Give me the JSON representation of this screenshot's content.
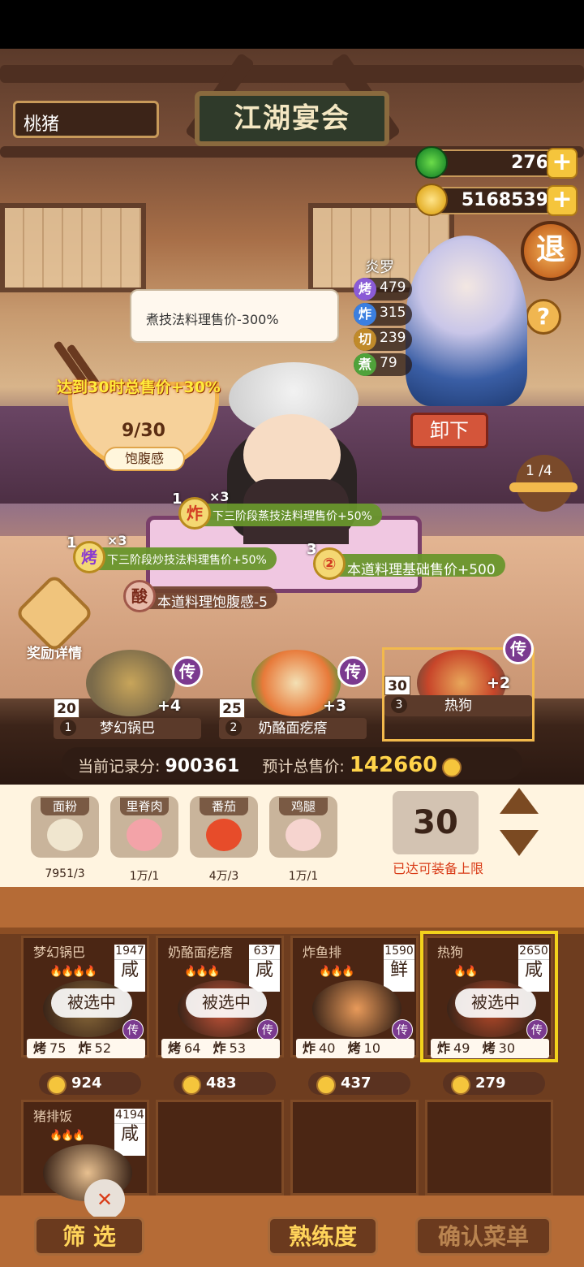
{
  "header": {
    "sign_title": "江湖宴会",
    "player_name": "桃猪",
    "jade": "276",
    "coins": "5168539",
    "plus": "+",
    "retreat_label": "退",
    "help_label": "?"
  },
  "character": {
    "name": "炎罗",
    "skills": [
      {
        "badge": "烤",
        "value": "479",
        "color": "#8a5bd6"
      },
      {
        "badge": "炸",
        "value": "315",
        "color": "#3b7fe0"
      },
      {
        "badge": "切",
        "value": "239",
        "color": "#c08a2a"
      },
      {
        "badge": "煮",
        "value": "79",
        "color": "#4fa23a"
      }
    ],
    "unload_label": "卸下",
    "page_indicator": "1 /4"
  },
  "stage": {
    "bubble_text": "煮技法料理售价-300%",
    "bowl_goal": "达到30时总售价+30%",
    "bowl_count": "9/30",
    "bowl_label": "饱腹感",
    "reward_label": "奖励详情"
  },
  "buffs": [
    {
      "num": "1",
      "icon": "炸",
      "mult": "×3",
      "text": "下三阶段蒸技法料理售价+50%"
    },
    {
      "num": "1",
      "icon": "烤",
      "mult": "×3",
      "text": "下三阶段炒技法料理售价+50%"
    },
    {
      "num": "3",
      "icon": "②",
      "mult": "",
      "text": "本道料理基础售价+500"
    },
    {
      "num": "",
      "icon": "酸",
      "mult": "",
      "text": "本道料理饱腹感-5"
    }
  ],
  "dish_slots": [
    {
      "index": "1",
      "qty": "20",
      "name": "梦幻锅巴",
      "bonus": "+4",
      "legend": "传"
    },
    {
      "index": "2",
      "qty": "25",
      "name": "奶酪面疙瘩",
      "bonus": "+3",
      "legend": "传"
    },
    {
      "index": "3",
      "qty": "30",
      "name": "热狗",
      "bonus": "+2",
      "legend": "传"
    }
  ],
  "score": {
    "record_label": "当前记录分:",
    "record_value": "900361",
    "total_label": "预计总售价:",
    "total_value": "142660"
  },
  "ingredients": [
    {
      "name": "面粉",
      "count": "7951/3",
      "color": "#f0e6cf"
    },
    {
      "name": "里脊肉",
      "count": "1万/1",
      "color": "#f3a3a8"
    },
    {
      "name": "番茄",
      "count": "4万/3",
      "color": "#e74c2a"
    },
    {
      "name": "鸡腿",
      "count": "1万/1",
      "color": "#f6d4cf"
    }
  ],
  "quantity": {
    "value": "30",
    "max_label": "已达可装备上限"
  },
  "recipes": [
    {
      "name": "梦幻锅巴",
      "price": "1947",
      "taste": "咸",
      "fires": "🔥🔥🔥🔥",
      "selected": "被选中",
      "legend": "传",
      "s1": "烤",
      "v1": "75",
      "s2": "炸",
      "v2": "52",
      "coin": "924"
    },
    {
      "name": "奶酪面疙瘩",
      "price": "637",
      "taste": "咸",
      "fires": "🔥🔥🔥",
      "selected": "被选中",
      "legend": "传",
      "s1": "烤",
      "v1": "64",
      "s2": "炸",
      "v2": "53",
      "coin": "483"
    },
    {
      "name": "炸鱼排",
      "price": "1590",
      "taste": "鲜",
      "fires": "🔥🔥🔥",
      "selected": "",
      "legend": "传",
      "s1": "炸",
      "v1": "40",
      "s2": "烤",
      "v2": "10",
      "coin": "437"
    },
    {
      "name": "热狗",
      "price": "2650",
      "taste": "咸",
      "fires": "🔥🔥",
      "selected": "被选中",
      "legend": "传",
      "s1": "炸",
      "v1": "49",
      "s2": "烤",
      "v2": "30",
      "coin": "279"
    },
    {
      "name": "猪排饭",
      "price": "4194",
      "taste": "咸",
      "fires": "🔥🔥🔥",
      "selected": "",
      "legend": "",
      "s1": "",
      "v1": "",
      "s2": "",
      "v2": "",
      "coin": ""
    }
  ],
  "bottom": {
    "filter_label": "筛 选",
    "proficiency_label": "熟练度",
    "confirm_label": "确认菜单"
  }
}
